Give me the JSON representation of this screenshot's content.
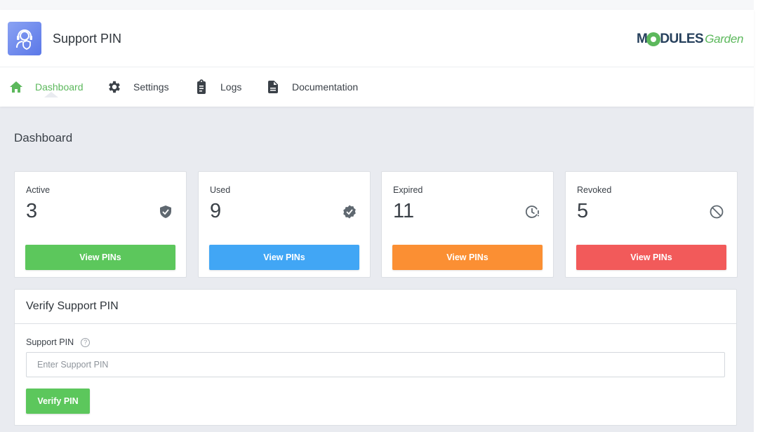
{
  "app": {
    "title": "Support PIN",
    "logo_icon": "headset-shield-icon",
    "brand_part1": "M",
    "brand_part2": "DULES",
    "brand_part3": "Garden"
  },
  "nav": [
    {
      "label": "Dashboard",
      "icon": "home-icon",
      "active": true
    },
    {
      "label": "Settings",
      "icon": "gear-icon",
      "active": false
    },
    {
      "label": "Logs",
      "icon": "clipboard-icon",
      "active": false
    },
    {
      "label": "Documentation",
      "icon": "document-icon",
      "active": false
    }
  ],
  "page_title": "Dashboard",
  "cards": [
    {
      "label": "Active",
      "value": "3",
      "icon": "shield-check-icon",
      "button": "View PINs",
      "color": "#5cc75c"
    },
    {
      "label": "Used",
      "value": "9",
      "icon": "badge-check-icon",
      "button": "View PINs",
      "color": "#41a6f5"
    },
    {
      "label": "Expired",
      "value": "11",
      "icon": "clock-alert-icon",
      "button": "View PINs",
      "color": "#fb8f33"
    },
    {
      "label": "Revoked",
      "value": "5",
      "icon": "ban-icon",
      "button": "View PINs",
      "color": "#f25a5a"
    }
  ],
  "verify": {
    "title": "Verify Support PIN",
    "field_label": "Support PIN",
    "help_glyph": "?",
    "placeholder": "Enter Support PIN",
    "value": "",
    "button": "Verify PIN"
  },
  "colors": {
    "accent": "#5cb85c",
    "background": "#e9ebf0"
  }
}
